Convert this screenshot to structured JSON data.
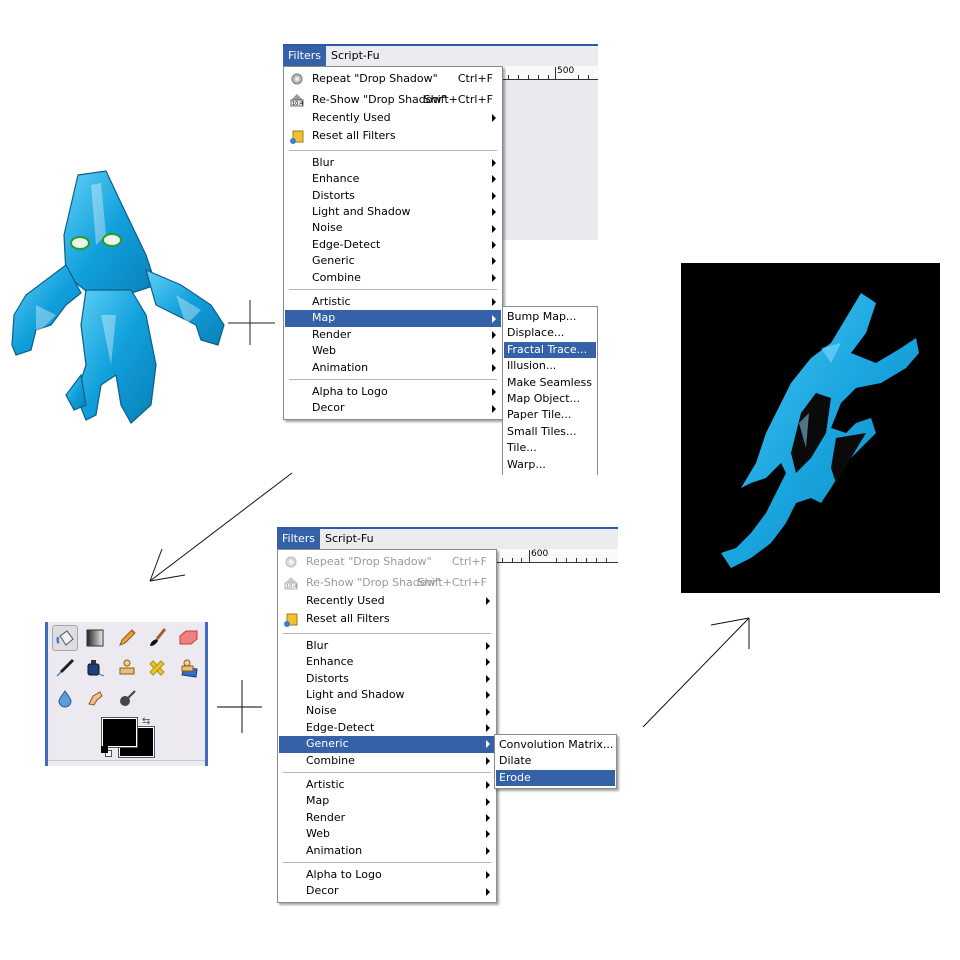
{
  "top_menu": {
    "menubar": [
      {
        "label": "Filters",
        "active": true
      },
      {
        "label": "Script-Fu",
        "active": false
      }
    ],
    "ruler_label": "500",
    "items": [
      {
        "label": "Repeat \"Drop Shadow\"",
        "accel": "Ctrl+F",
        "icon": "repeat-icon",
        "disabled": false
      },
      {
        "label": "Re-Show \"Drop Shadow\"",
        "accel": "Shift+Ctrl+F",
        "icon": "reshow-icon",
        "disabled": false
      },
      {
        "label": "Recently Used",
        "submenu": true
      },
      {
        "label": "Reset all Filters",
        "icon": "reset-icon"
      },
      {
        "separator": true
      },
      {
        "label": "Blur",
        "submenu": true
      },
      {
        "label": "Enhance",
        "submenu": true
      },
      {
        "label": "Distorts",
        "submenu": true
      },
      {
        "label": "Light and Shadow",
        "submenu": true
      },
      {
        "label": "Noise",
        "submenu": true
      },
      {
        "label": "Edge-Detect",
        "submenu": true
      },
      {
        "label": "Generic",
        "submenu": true
      },
      {
        "label": "Combine",
        "submenu": true
      },
      {
        "separator": true
      },
      {
        "label": "Artistic",
        "submenu": true
      },
      {
        "label": "Map",
        "submenu": true,
        "selected": true
      },
      {
        "label": "Render",
        "submenu": true
      },
      {
        "label": "Web",
        "submenu": true
      },
      {
        "label": "Animation",
        "submenu": true
      },
      {
        "separator": true
      },
      {
        "label": "Alpha to Logo",
        "submenu": true
      },
      {
        "label": "Decor",
        "submenu": true
      }
    ],
    "submenu": [
      {
        "label": "Bump Map..."
      },
      {
        "label": "Displace..."
      },
      {
        "label": "Fractal Trace...",
        "selected": true
      },
      {
        "label": "Illusion..."
      },
      {
        "label": "Make Seamless"
      },
      {
        "label": "Map Object..."
      },
      {
        "label": "Paper Tile..."
      },
      {
        "label": "Small Tiles..."
      },
      {
        "label": "Tile..."
      },
      {
        "label": "Warp..."
      }
    ]
  },
  "bottom_menu": {
    "menubar": [
      {
        "label": "Filters",
        "active": true
      },
      {
        "label": "Script-Fu",
        "active": false
      }
    ],
    "ruler_label": "600",
    "items": [
      {
        "label": "Repeat \"Drop Shadow\"",
        "accel": "Ctrl+F",
        "icon": "repeat-icon",
        "disabled": true
      },
      {
        "label": "Re-Show \"Drop Shadow\"",
        "accel": "Shift+Ctrl+F",
        "icon": "reshow-icon",
        "disabled": true
      },
      {
        "label": "Recently Used",
        "submenu": true
      },
      {
        "label": "Reset all Filters",
        "icon": "reset-icon"
      },
      {
        "separator": true
      },
      {
        "label": "Blur",
        "submenu": true
      },
      {
        "label": "Enhance",
        "submenu": true
      },
      {
        "label": "Distorts",
        "submenu": true
      },
      {
        "label": "Light and Shadow",
        "submenu": true
      },
      {
        "label": "Noise",
        "submenu": true
      },
      {
        "label": "Edge-Detect",
        "submenu": true
      },
      {
        "label": "Generic",
        "submenu": true,
        "selected": true
      },
      {
        "label": "Combine",
        "submenu": true
      },
      {
        "separator": true
      },
      {
        "label": "Artistic",
        "submenu": true
      },
      {
        "label": "Map",
        "submenu": true
      },
      {
        "label": "Render",
        "submenu": true
      },
      {
        "label": "Web",
        "submenu": true
      },
      {
        "label": "Animation",
        "submenu": true
      },
      {
        "separator": true
      },
      {
        "label": "Alpha to Logo",
        "submenu": true
      },
      {
        "label": "Decor",
        "submenu": true
      }
    ],
    "submenu": [
      {
        "label": "Convolution Matrix..."
      },
      {
        "label": "Dilate"
      },
      {
        "label": "Erode",
        "selected": true
      }
    ]
  },
  "toolbox": {
    "tools": [
      "bucket-fill-icon",
      "blend-gradient-icon",
      "pencil-icon",
      "paintbrush-icon",
      "eraser-icon",
      "airbrush-icon",
      "ink-icon",
      "clone-stamp-icon",
      "heal-icon",
      "perspective-clone-icon",
      "blur-sharpen-icon",
      "smudge-icon",
      "dodge-burn-icon"
    ],
    "active_tool": "bucket-fill-icon",
    "foreground_color": "#000000",
    "background_color": "#000000"
  },
  "images": {
    "source_character": "blue 3D creature",
    "result_fractal": "blue fractal-traced shape on black"
  },
  "colors": {
    "menu_selection": "#3561a9",
    "creature_blue": "#1aa6e0",
    "fractal_background": "#000000"
  }
}
